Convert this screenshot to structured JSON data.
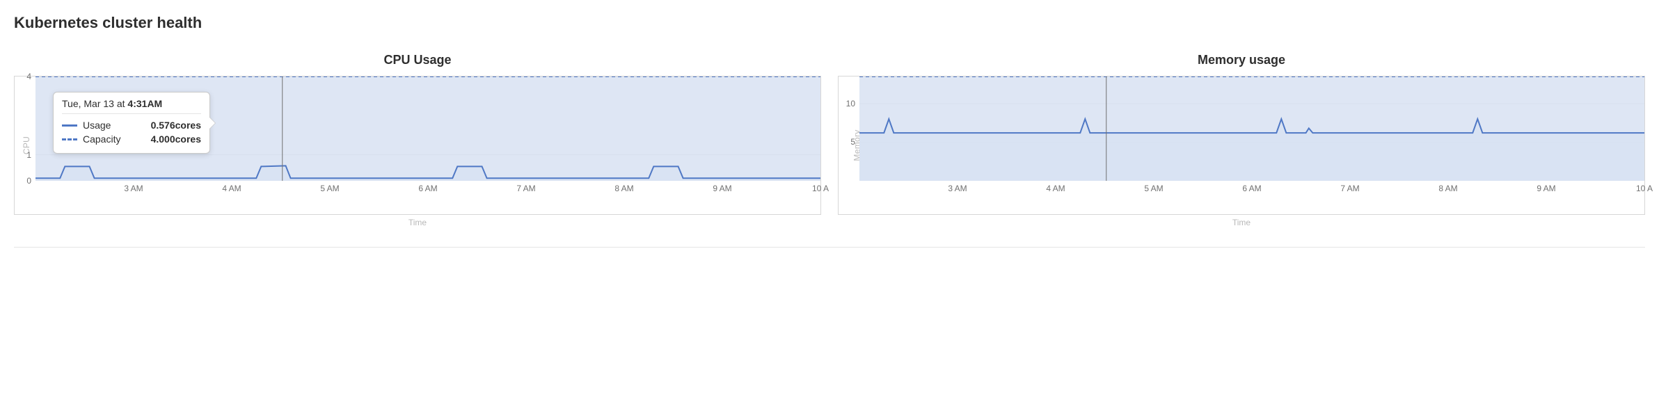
{
  "section_title": "Kubernetes cluster health",
  "tooltip": {
    "header_prefix": "Tue, Mar 13 at ",
    "header_time": "4:31AM",
    "rows": {
      "usage": {
        "label": "Usage",
        "value": "0.576cores"
      },
      "capacity": {
        "label": "Capacity",
        "value": "4.000cores"
      }
    }
  },
  "charts": {
    "cpu": {
      "title": "CPU Usage",
      "ylabel": "CPU",
      "xlabel": "Time"
    },
    "memory": {
      "title": "Memory usage",
      "ylabel": "Memory",
      "xlabel": "Time"
    }
  },
  "chart_data": [
    {
      "id": "cpu",
      "type": "line",
      "title": "CPU Usage",
      "xlabel": "Time",
      "ylabel": "CPU",
      "ylim": [
        0,
        4
      ],
      "yticks": [
        0,
        1,
        4
      ],
      "x_ticks": [
        "3 AM",
        "4 AM",
        "5 AM",
        "6 AM",
        "7 AM",
        "8 AM",
        "9 AM",
        "10 A"
      ],
      "x_range_hours": [
        2,
        10
      ],
      "cursor_hour": 4.516,
      "series": [
        {
          "name": "Capacity",
          "style": "dashed",
          "fill": true,
          "color": "#4f78c5",
          "points": [
            {
              "x": 2.0,
              "y": 4.0
            },
            {
              "x": 10.0,
              "y": 4.0
            }
          ]
        },
        {
          "name": "Usage",
          "style": "solid",
          "fill": true,
          "color": "#4f78c5",
          "points": [
            {
              "x": 2.0,
              "y": 0.1
            },
            {
              "x": 2.25,
              "y": 0.1
            },
            {
              "x": 2.3,
              "y": 0.55
            },
            {
              "x": 2.55,
              "y": 0.55
            },
            {
              "x": 2.6,
              "y": 0.1
            },
            {
              "x": 4.25,
              "y": 0.1
            },
            {
              "x": 4.3,
              "y": 0.55
            },
            {
              "x": 4.55,
              "y": 0.576
            },
            {
              "x": 4.6,
              "y": 0.1
            },
            {
              "x": 6.25,
              "y": 0.1
            },
            {
              "x": 6.3,
              "y": 0.55
            },
            {
              "x": 6.55,
              "y": 0.55
            },
            {
              "x": 6.6,
              "y": 0.1
            },
            {
              "x": 8.25,
              "y": 0.1
            },
            {
              "x": 8.3,
              "y": 0.55
            },
            {
              "x": 8.55,
              "y": 0.55
            },
            {
              "x": 8.6,
              "y": 0.1
            },
            {
              "x": 10.0,
              "y": 0.1
            }
          ]
        }
      ]
    },
    {
      "id": "memory",
      "type": "line",
      "title": "Memory usage",
      "xlabel": "Time",
      "ylabel": "Memory",
      "ylim": [
        0,
        13.5
      ],
      "yticks": [
        5,
        10
      ],
      "x_ticks": [
        "3 AM",
        "4 AM",
        "5 AM",
        "6 AM",
        "7 AM",
        "8 AM",
        "9 AM",
        "10 A"
      ],
      "x_range_hours": [
        2,
        10
      ],
      "cursor_hour": 4.516,
      "series": [
        {
          "name": "Capacity",
          "style": "dashed",
          "fill": true,
          "color": "#4f78c5",
          "points": [
            {
              "x": 2.0,
              "y": 13.5
            },
            {
              "x": 10.0,
              "y": 13.5
            }
          ]
        },
        {
          "name": "Usage",
          "style": "solid",
          "fill": true,
          "color": "#4f78c5",
          "points": [
            {
              "x": 2.0,
              "y": 6.2
            },
            {
              "x": 2.25,
              "y": 6.2
            },
            {
              "x": 2.3,
              "y": 8.0
            },
            {
              "x": 2.35,
              "y": 6.2
            },
            {
              "x": 4.25,
              "y": 6.2
            },
            {
              "x": 4.3,
              "y": 8.0
            },
            {
              "x": 4.35,
              "y": 6.2
            },
            {
              "x": 6.25,
              "y": 6.2
            },
            {
              "x": 6.3,
              "y": 8.0
            },
            {
              "x": 6.35,
              "y": 6.2
            },
            {
              "x": 6.55,
              "y": 6.2
            },
            {
              "x": 6.58,
              "y": 6.8
            },
            {
              "x": 6.62,
              "y": 6.2
            },
            {
              "x": 8.25,
              "y": 6.2
            },
            {
              "x": 8.3,
              "y": 8.0
            },
            {
              "x": 8.35,
              "y": 6.2
            },
            {
              "x": 10.0,
              "y": 6.2
            }
          ]
        }
      ]
    }
  ]
}
